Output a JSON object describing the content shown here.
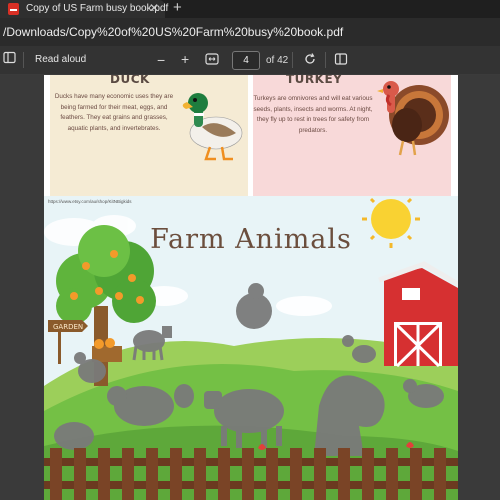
{
  "tab": {
    "title": "Copy of US Farm busy book.pdf",
    "close": "✕",
    "new_tab": "+"
  },
  "address": {
    "url": "/Downloads/Copy%20of%20US%20Farm%20busy%20book.pdf"
  },
  "toolbar": {
    "read_aloud": "Read aloud",
    "zoom_out": "−",
    "zoom_in": "+",
    "page_current": "4",
    "page_of": "of 42"
  },
  "page_top": {
    "duck": {
      "title": "DUCK",
      "text": "Ducks have many economic uses they are being farmed for their meat, eggs, and feathers. They eat grains and grasses, aquatic plants, and invertebrates."
    },
    "turkey": {
      "title": "TURKEY",
      "text": "Turkeys are omnivores and will eat various seeds, plants, insects and worms. At night, they fly up to rest in trees for safety from predators."
    },
    "source": "https://www.etsy.com/au/shop/KitNBigkids"
  },
  "page_main": {
    "source": "https://www.etsy.com/au/shop/KitNBigkids",
    "title": "Farm Animals",
    "sign": "GARDEN"
  },
  "colors": {
    "accent": "#d93025",
    "barn": "#d63031",
    "grass": "#74c045",
    "fence": "#6b3a20"
  }
}
